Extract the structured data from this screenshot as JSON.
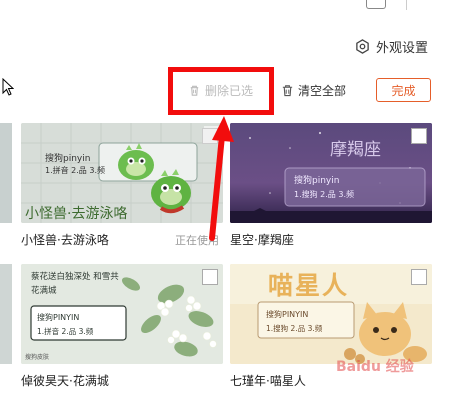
{
  "header": {
    "appearance_label": "外观设置",
    "appearance_icon": "gear-icon"
  },
  "toolbar": {
    "delete_selected_label": "删除已选",
    "clear_all_label": "清空全部",
    "done_label": "完成"
  },
  "skins": [
    {
      "name": "小怪兽·去游泳咯",
      "banner": "小怪兽·去游泳咯",
      "input_title": "搜狗pinyin",
      "candidates": "1.拼音 2.品 3.频",
      "status": "正在使用"
    },
    {
      "name": "星空·摩羯座",
      "banner": "摩羯座",
      "input_title": "搜狗pinyin",
      "candidates": "1.搜狗 2.品 3.频"
    },
    {
      "name": "倬彼昊天·花满城",
      "banner": "蔡花送白独深处 和雪共花满城",
      "input_title": "搜狗PINYIN",
      "candidates": "1.拼音 2.品 3.频",
      "footer": "搜狗皮肤"
    },
    {
      "name": "七瑾年·喵星人",
      "banner": "喵星人",
      "input_title": "搜狗PINYIN",
      "candidates": "1.搜狗 2.品 3.频"
    }
  ],
  "watermark": "Baidu 经验",
  "colors": {
    "accent": "#e55e2a",
    "highlight_border": "#f20d0d"
  }
}
